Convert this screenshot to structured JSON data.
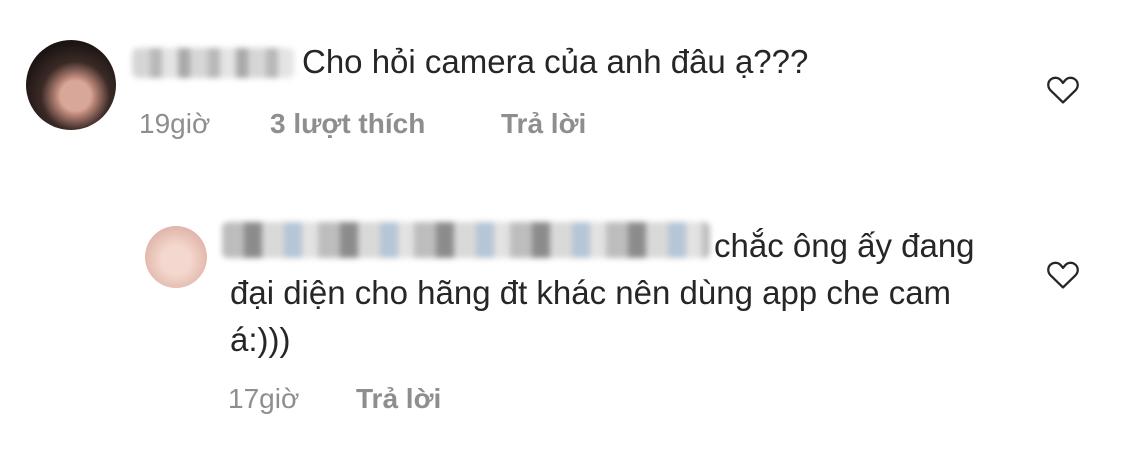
{
  "comment_1": {
    "text": "Cho hỏi camera của anh đâu ạ???",
    "time": "19giờ",
    "likes": "3 lượt thích",
    "reply": "Trả lời",
    "like_icon": "heart-outline-icon"
  },
  "reply_1": {
    "text": "chắc ông ấy đang đại diện cho hãng đt khác nên dùng app che cam á:)))",
    "time": "17giờ",
    "reply": "Trả lời",
    "like_icon": "heart-outline-icon"
  },
  "colors": {
    "text": "#262626",
    "meta": "#8e8e8e",
    "background": "#ffffff"
  }
}
